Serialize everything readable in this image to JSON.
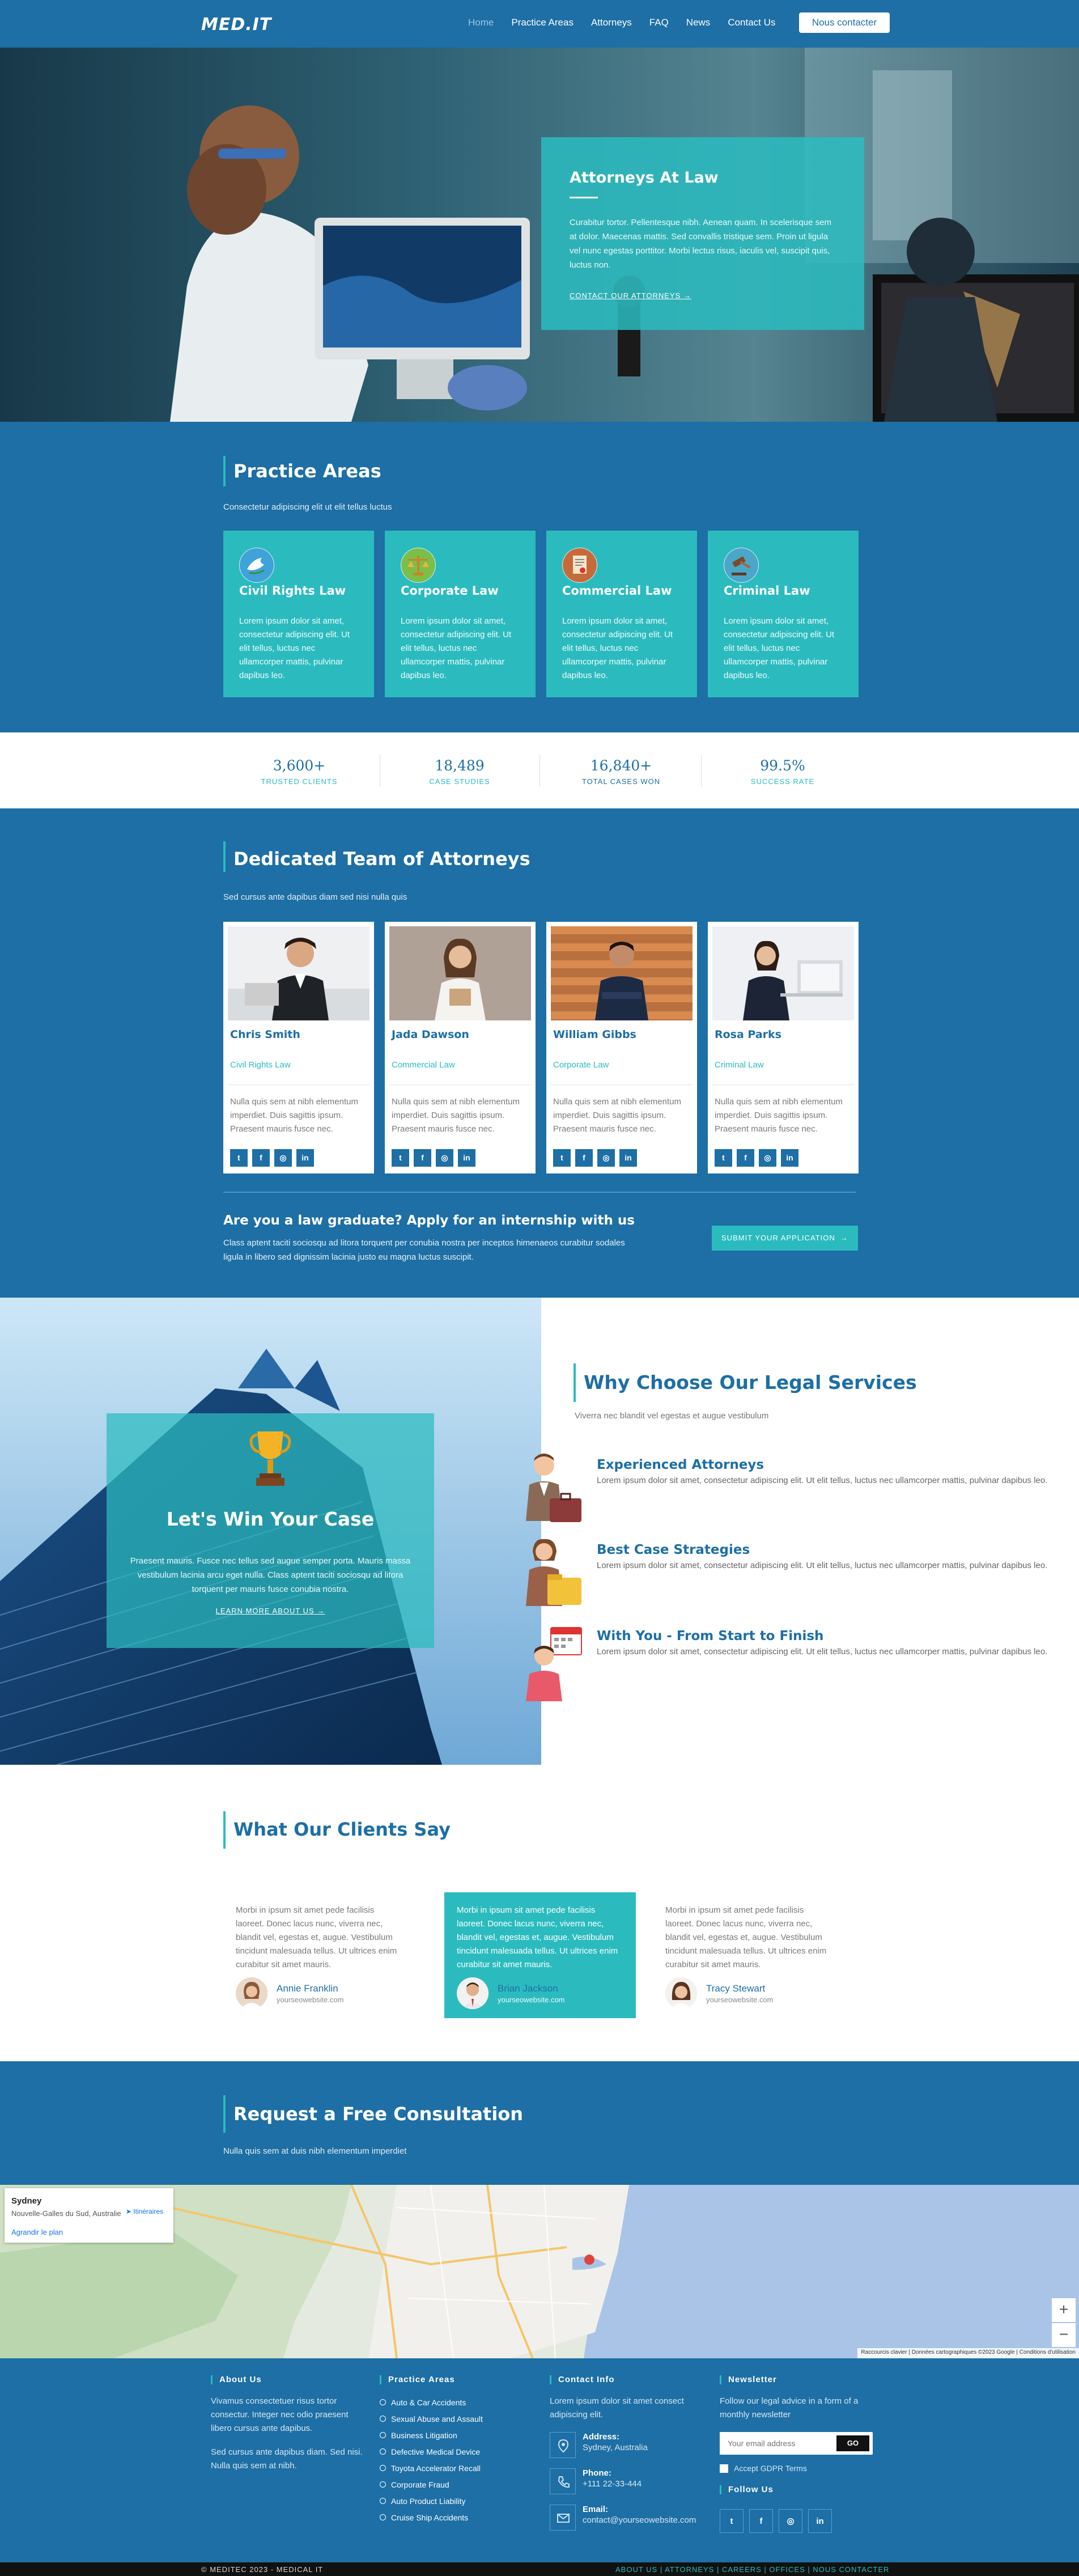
{
  "header": {
    "logo": "MED.IT",
    "nav": [
      "Home",
      "Practice Areas",
      "Attorneys",
      "FAQ",
      "News",
      "Contact Us"
    ],
    "cta": "Nous contacter"
  },
  "hero": {
    "title": "Attorneys At Law",
    "text": "Curabitur tortor. Pellentesque nibh. Aenean quam. In scelerisque sem at dolor. Maecenas mattis. Sed convallis tristique sem. Proin ut ligula vel nunc egestas porttitor. Morbi lectus risus, iaculis vel, suscipit quis, luctus non.",
    "link": "CONTACT OUR ATTORNEYS"
  },
  "practice": {
    "title": "Practice Areas",
    "subtitle": "Consectetur adipiscing elit ut elit tellus luctus",
    "cards": [
      {
        "title": "Civil Rights Law",
        "text": "Lorem ipsum dolor sit amet, consectetur adipiscing elit. Ut elit tellus, luctus nec ullamcorper mattis, pulvinar dapibus leo.",
        "icon": "dove-icon"
      },
      {
        "title": "Corporate Law",
        "text": "Lorem ipsum dolor sit amet, consectetur adipiscing elit. Ut elit tellus, luctus nec ullamcorper mattis, pulvinar dapibus leo.",
        "icon": "scales-icon"
      },
      {
        "title": "Commercial Law",
        "text": "Lorem ipsum dolor sit amet, consectetur adipiscing elit. Ut elit tellus, luctus nec ullamcorper mattis, pulvinar dapibus leo.",
        "icon": "document-icon"
      },
      {
        "title": "Criminal Law",
        "text": "Lorem ipsum dolor sit amet, consectetur adipiscing elit. Ut elit tellus, luctus nec ullamcorper mattis, pulvinar dapibus leo.",
        "icon": "gavel-icon"
      }
    ]
  },
  "stats": [
    {
      "number": "3,600+",
      "label": "TRUSTED CLIENTS"
    },
    {
      "number": "18,489",
      "label": "CASE STUDIES"
    },
    {
      "number": "16,840+",
      "label": "TOTAL CASES WON"
    },
    {
      "number": "99.5%",
      "label": "SUCCESS RATE"
    }
  ],
  "team": {
    "title": "Dedicated Team of Attorneys",
    "subtitle": "Sed cursus ante dapibus diam sed nisi nulla quis",
    "members": [
      {
        "name": "Chris Smith",
        "role": "Civil Rights Law",
        "text": "Nulla quis sem at nibh elementum imperdiet. Duis sagittis ipsum. Praesent mauris fusce nec."
      },
      {
        "name": "Jada Dawson",
        "role": "Commercial Law",
        "text": "Nulla quis sem at nibh elementum imperdiet. Duis sagittis ipsum. Praesent mauris fusce nec."
      },
      {
        "name": "William Gibbs",
        "role": "Corporate Law",
        "text": "Nulla quis sem at nibh elementum imperdiet. Duis sagittis ipsum. Praesent mauris fusce nec."
      },
      {
        "name": "Rosa Parks",
        "role": "Criminal Law",
        "text": "Nulla quis sem at nibh elementum imperdiet. Duis sagittis ipsum. Praesent mauris fusce nec."
      }
    ],
    "social": [
      "twitter-icon",
      "facebook-icon",
      "instagram-icon",
      "linkedin-icon"
    ],
    "internship_title": "Are you a law graduate? Apply for an internship with us",
    "internship_text": "Class aptent taciti sociosqu ad litora torquent per conubia nostra per inceptos himenaeos curabitur sodales ligula in libero sed dignissim lacinia justo eu magna luctus suscipit.",
    "internship_button": "SUBMIT YOUR APPLICATION"
  },
  "why": {
    "box_title": "Let's Win Your Case",
    "box_text": "Praesent mauris. Fusce nec tellus sed augue semper porta. Mauris massa vestibulum lacinia arcu eget nulla. Class aptent taciti sociosqu ad litora torquent per mauris fusce conubia nostra.",
    "box_link": "LEARN MORE ABOUT US",
    "title": "Why Choose Our Legal Services",
    "subtitle": "Viverra nec blandit vel egestas et augue vestibulum",
    "features": [
      {
        "title": "Experienced Attorneys",
        "text": "Lorem ipsum dolor sit amet, consectetur adipiscing elit. Ut elit tellus, luctus nec ullamcorper mattis, pulvinar dapibus leo."
      },
      {
        "title": "Best Case Strategies",
        "text": "Lorem ipsum dolor sit amet, consectetur adipiscing elit. Ut elit tellus, luctus nec ullamcorper mattis, pulvinar dapibus leo."
      },
      {
        "title": "With You - From Start to Finish",
        "text": "Lorem ipsum dolor sit amet, consectetur adipiscing elit. Ut elit tellus, luctus nec ullamcorper mattis, pulvinar dapibus leo."
      }
    ]
  },
  "testimonials": {
    "title": "What Our Clients Say",
    "items": [
      {
        "text": "Morbi in ipsum sit amet pede facilisis laoreet. Donec lacus nunc, viverra nec, blandit vel, egestas et, augue. Vestibulum tincidunt malesuada tellus. Ut ultrices enim curabitur sit amet mauris.",
        "name": "Annie Franklin",
        "site": "yourseowebsite.com"
      },
      {
        "text": "Morbi in ipsum sit amet pede facilisis laoreet. Donec lacus nunc, viverra nec, blandit vel, egestas et, augue. Vestibulum tincidunt malesuada tellus. Ut ultrices enim curabitur sit amet mauris.",
        "name": "Brian Jackson",
        "site": "yourseowebsite.com"
      },
      {
        "text": "Morbi in ipsum sit amet pede facilisis laoreet. Donec lacus nunc, viverra nec, blandit vel, egestas et, augue. Vestibulum tincidunt malesuada tellus. Ut ultrices enim curabitur sit amet mauris.",
        "name": "Tracy Stewart",
        "site": "yourseowebsite.com"
      }
    ]
  },
  "consultation": {
    "title": "Request a Free Consultation",
    "subtitle": "Nulla quis sem at duis nibh elementum imperdiet"
  },
  "map": {
    "city": "Sydney",
    "region": "Nouvelle-Galles du Sud, Australie",
    "view_link": "Agrandir le plan",
    "directions": "Itinéraires",
    "attribution": "Raccourcis clavier | Données cartographiques ©2023 Google | Conditions d'utilisation"
  },
  "footer": {
    "about_title": "About Us",
    "about_text1": "Vivamus consectetuer risus tortor consectur. Integer nec odio praesent libero cursus ante dapibus.",
    "about_text2": "Sed cursus ante dapibus diam. Sed nisi. Nulla quis sem at nibh.",
    "practice_title": "Practice Areas",
    "practice_items": [
      "Auto & Car Accidents",
      "Sexual Abuse and Assault",
      "Business Litigation",
      "Defective Medical Device",
      "Toyota Accelerator Recall",
      "Corporate Fraud",
      "Auto Product Liability",
      "Cruise Ship Accidents"
    ],
    "contact_title": "Contact Info",
    "contact_text": "Lorem ipsum dolor sit amet consect adipiscing elit.",
    "address_label": "Address:",
    "address": "Sydney, Australia",
    "phone_label": "Phone:",
    "phone": "+111 22-33-444",
    "email_label": "Email:",
    "email": "contact@yourseowebsite.com",
    "newsletter_title": "Newsletter",
    "newsletter_text": "Follow our legal advice in a form of a monthly newsletter",
    "email_placeholder": "Your email address",
    "go": "GO",
    "gdpr": "Accept GDPR Terms",
    "follow_title": "Follow Us",
    "copyright": "© MEDITEC 2023 - MEDICAL IT",
    "bottom_links": "ABOUT US | ATTORNEYS | CAREERS | OFFICES | NOUS CONTACTER"
  }
}
